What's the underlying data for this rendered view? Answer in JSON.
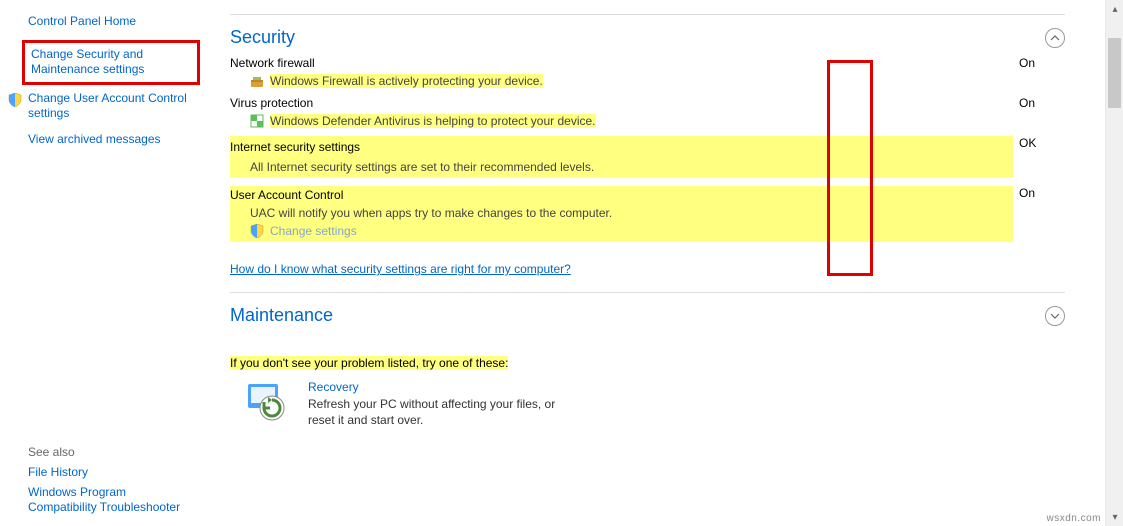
{
  "sidebar": {
    "home": "Control Panel Home",
    "change_sec": "Change Security and Maintenance settings",
    "change_uac": "Change User Account Control settings",
    "archived": "View archived messages"
  },
  "see_also": {
    "title": "See also",
    "file_history": "File History",
    "wpct": "Windows Program Compatibility Troubleshooter"
  },
  "security": {
    "title": "Security",
    "firewall": {
      "label": "Network firewall",
      "detail": "Windows Firewall is actively protecting your device.",
      "status": "On"
    },
    "virus": {
      "label": "Virus protection",
      "detail": "Windows Defender Antivirus is helping to protect your device.",
      "status": "On"
    },
    "internet": {
      "label": "Internet security settings",
      "detail": "All Internet security settings are set to their recommended levels.",
      "status": "OK"
    },
    "uac": {
      "label": "User Account Control",
      "detail": "UAC will notify you when apps try to make changes to the computer.",
      "change": "Change settings",
      "status": "On"
    },
    "help": "How do I know what security settings are right for my computer?"
  },
  "maintenance": {
    "title": "Maintenance"
  },
  "troubleshoot_hint": "If you don't see your problem listed, try one of these:",
  "recovery": {
    "title": "Recovery",
    "desc": "Refresh your PC without affecting your files, or reset it and start over."
  },
  "watermark": "wsxdn.com"
}
